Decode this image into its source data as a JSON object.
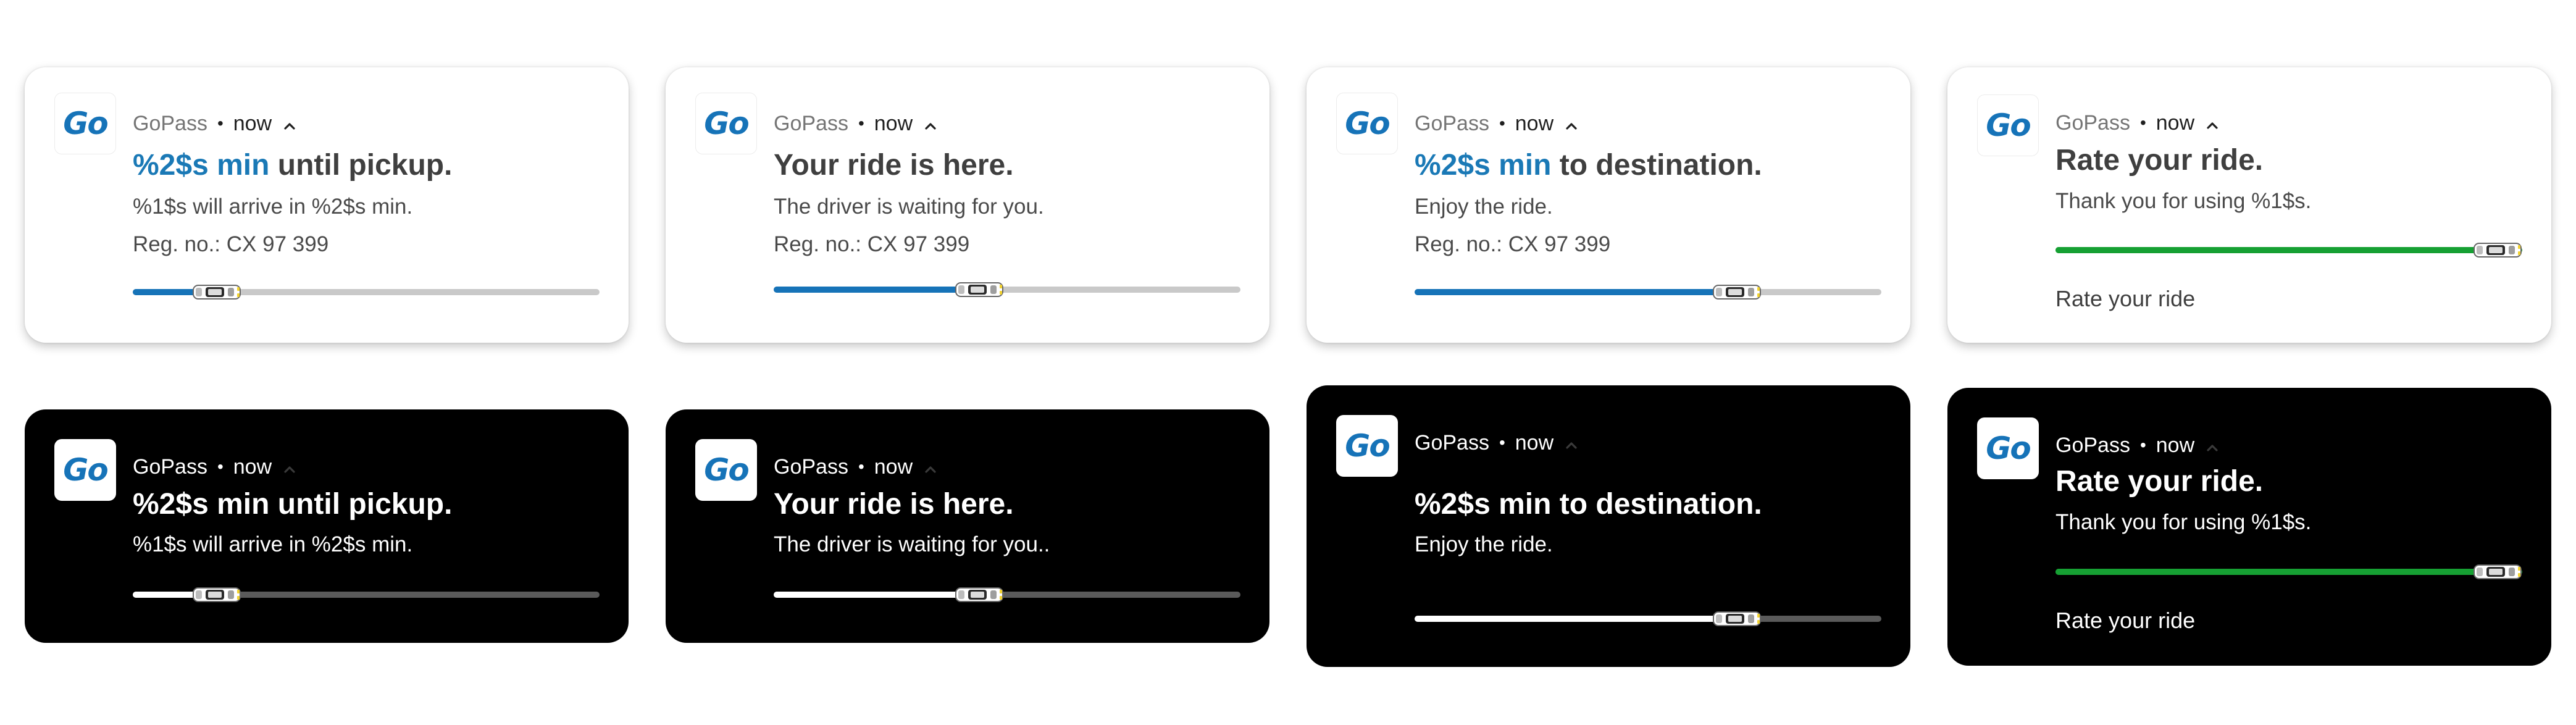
{
  "app": {
    "name": "GoPass",
    "time": "now",
    "icon_text": "Go",
    "icon": "gopass-logo-icon",
    "brand_color": "#1a79b6",
    "progress_blue": "#1673b8",
    "progress_green": "#16a033"
  },
  "light_cards": [
    {
      "title_accent": "%2$s min",
      "title_rest": " until pickup.",
      "line1": "%1$s will arrive in %2$s min.",
      "line2": "Reg. no.: CX 97 399",
      "progress": 0.18
    },
    {
      "title_accent": "",
      "title_rest": "Your ride is here.",
      "line1": "The driver is waiting for you.",
      "line2": "Reg. no.: CX 97 399",
      "progress": 0.44
    },
    {
      "title_accent": "%2$s min",
      "title_rest": " to destination.",
      "line1": "Enjoy the ride.",
      "line2": "Reg. no.: CX 97 399",
      "progress": 0.69
    },
    {
      "title": "Rate your ride.",
      "line1": "Thank you for using %1$s.",
      "progress": 0.95,
      "action": "Rate your ride"
    }
  ],
  "dark_cards": [
    {
      "title": "%2$s min until pickup.",
      "line1": "%1$s will arrive in %2$s min.",
      "progress": 0.18
    },
    {
      "title": "Your ride is here.",
      "line1": "The driver is waiting for you..",
      "progress": 0.44
    },
    {
      "title": "%2$s min to destination.",
      "line1": "Enjoy the ride.",
      "progress": 0.69
    },
    {
      "title": "Rate your ride.",
      "line1": "Thank you for using %1$s.",
      "progress": 0.95,
      "action": "Rate your ride"
    }
  ]
}
